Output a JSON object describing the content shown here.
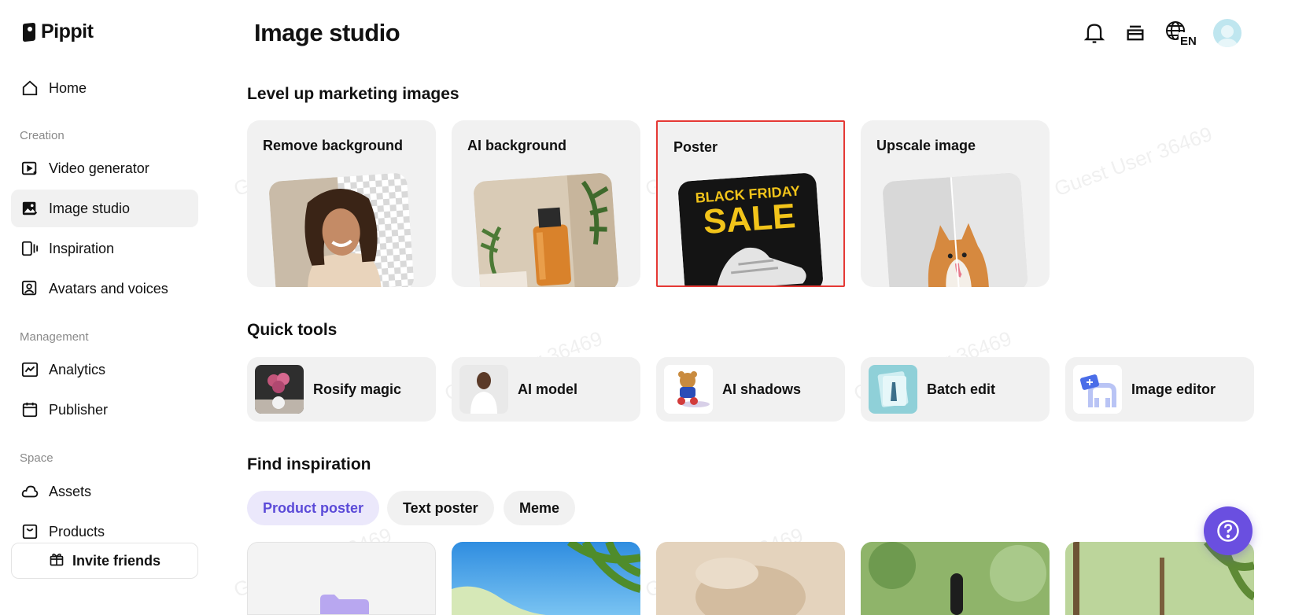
{
  "app": {
    "name": "Pippit"
  },
  "sidebar": {
    "home": "Home",
    "sections": {
      "creation": "Creation",
      "management": "Management",
      "space": "Space"
    },
    "items": [
      {
        "label": "Video generator",
        "icon": "video-play-icon"
      },
      {
        "label": "Image studio",
        "icon": "image-sparkle-icon",
        "active": true
      },
      {
        "label": "Inspiration",
        "icon": "inspiration-icon"
      },
      {
        "label": "Avatars and voices",
        "icon": "avatar-icon"
      },
      {
        "label": "Analytics",
        "icon": "analytics-icon"
      },
      {
        "label": "Publisher",
        "icon": "calendar-icon"
      },
      {
        "label": "Assets",
        "icon": "cloud-icon"
      },
      {
        "label": "Products",
        "icon": "product-icon"
      }
    ],
    "invite": "Invite friends"
  },
  "header": {
    "title": "Image studio",
    "lang": "EN"
  },
  "sections": {
    "marketing": "Level up marketing images",
    "quick": "Quick tools",
    "inspiration": "Find inspiration"
  },
  "features": [
    {
      "label": "Remove background"
    },
    {
      "label": "AI background"
    },
    {
      "label": "Poster",
      "poster_line1": "BLACK FRIDAY",
      "poster_line2": "SALE"
    },
    {
      "label": "Upscale image"
    }
  ],
  "tools": [
    {
      "label": "Rosify magic"
    },
    {
      "label": "AI model"
    },
    {
      "label": "AI shadows"
    },
    {
      "label": "Batch edit"
    },
    {
      "label": "Image editor"
    }
  ],
  "chips": [
    {
      "label": "Product poster",
      "active": true
    },
    {
      "label": "Text poster"
    },
    {
      "label": "Meme"
    }
  ],
  "watermark": "Guest User 36469",
  "colors": {
    "accent": "#6a4fe0",
    "chip_active_bg": "#ebe8fb",
    "selection_border": "#e53935"
  }
}
